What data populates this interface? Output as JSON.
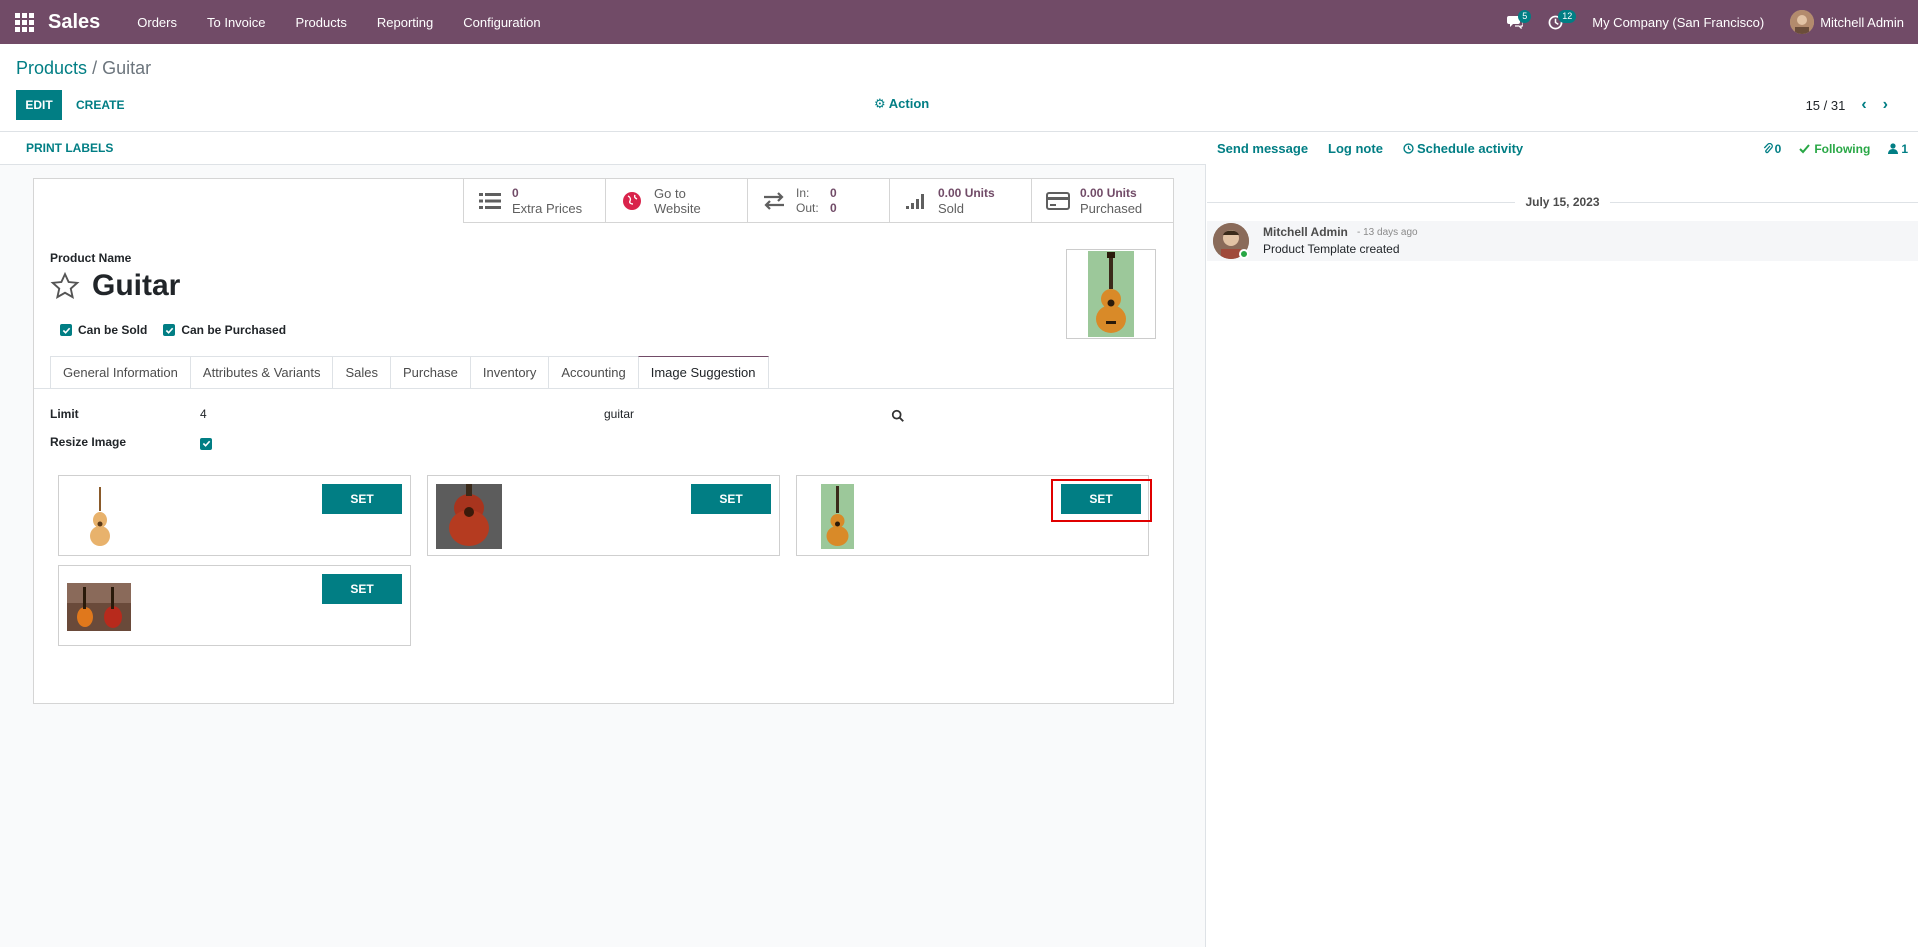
{
  "navbar": {
    "brand": "Sales",
    "menu": [
      "Orders",
      "To Invoice",
      "Products",
      "Reporting",
      "Configuration"
    ],
    "messages_count": "5",
    "activities_count": "12",
    "company": "My Company (San Francisco)",
    "user": "Mitchell Admin"
  },
  "breadcrumb": {
    "parent": "Products",
    "separator": "/",
    "current": "Guitar"
  },
  "controls": {
    "edit_label": "EDIT",
    "create_label": "CREATE",
    "action_label": "Action",
    "pager": "15 / 31"
  },
  "statusbar": {
    "print_labels": "PRINT LABELS"
  },
  "smart_buttons": {
    "extra_prices_value": "0",
    "extra_prices_label": "Extra Prices",
    "website_line1": "Go to",
    "website_line2": "Website",
    "in_label": "In:",
    "in_value": "0",
    "out_label": "Out:",
    "out_value": "0",
    "sold_value": "0.00 Units",
    "sold_label": "Sold",
    "purchased_value": "0.00 Units",
    "purchased_label": "Purchased"
  },
  "product": {
    "name_label": "Product Name",
    "name": "Guitar",
    "can_be_sold_label": "Can be Sold",
    "can_be_purchased_label": "Can be Purchased",
    "can_be_sold": true,
    "can_be_purchased": true
  },
  "tabs": [
    "General Information",
    "Attributes & Variants",
    "Sales",
    "Purchase",
    "Inventory",
    "Accounting",
    "Image Suggestion"
  ],
  "active_tab": "Image Suggestion",
  "image_suggestion": {
    "limit_label": "Limit",
    "limit_value": "4",
    "query": "guitar",
    "resize_label": "Resize Image",
    "resize": true,
    "set_label": "SET"
  },
  "chatter": {
    "send_message": "Send message",
    "log_note": "Log note",
    "schedule_activity": "Schedule activity",
    "attachments_count": "0",
    "following": "Following",
    "followers_count": "1",
    "date": "July 15, 2023",
    "message": {
      "author": "Mitchell Admin",
      "time": "- 13 days ago",
      "body": "Product Template created"
    }
  },
  "colors": {
    "brand": "#714b67",
    "primary": "#017e84",
    "highlight": "#e00000",
    "following": "#28a745"
  }
}
